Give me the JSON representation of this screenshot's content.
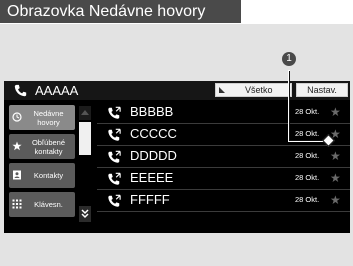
{
  "header": {
    "title": "Obrazovka Nedávne hovory"
  },
  "topbar": {
    "contact": "AAAAA",
    "filter_label": "Všetko",
    "settings_label": "Nastav."
  },
  "sidebar": {
    "items": [
      {
        "label": "Nedávne hovory",
        "icon": "clock-icon",
        "active": true
      },
      {
        "label": "Obľúbené kontakty",
        "icon": "star-icon",
        "active": false
      },
      {
        "label": "Kontakty",
        "icon": "contacts-book-icon",
        "active": false
      },
      {
        "label": "Klávesn.",
        "icon": "keypad-icon",
        "active": false
      }
    ]
  },
  "calls": [
    {
      "name": "BBBBB",
      "date": "28 Okt."
    },
    {
      "name": "CCCCC",
      "date": "28 Okt."
    },
    {
      "name": "DDDDD",
      "date": "28 Okt."
    },
    {
      "name": "EEEEE",
      "date": "28 Okt."
    },
    {
      "name": "FFFFF",
      "date": "28 Okt."
    }
  ],
  "callout": {
    "number": "1"
  },
  "colors": {
    "screen_bg": "#000000",
    "frame_bg": "#e3e3e3",
    "header_bg": "#4a4a4a",
    "sidebar_btn": "#5b5b5b"
  }
}
